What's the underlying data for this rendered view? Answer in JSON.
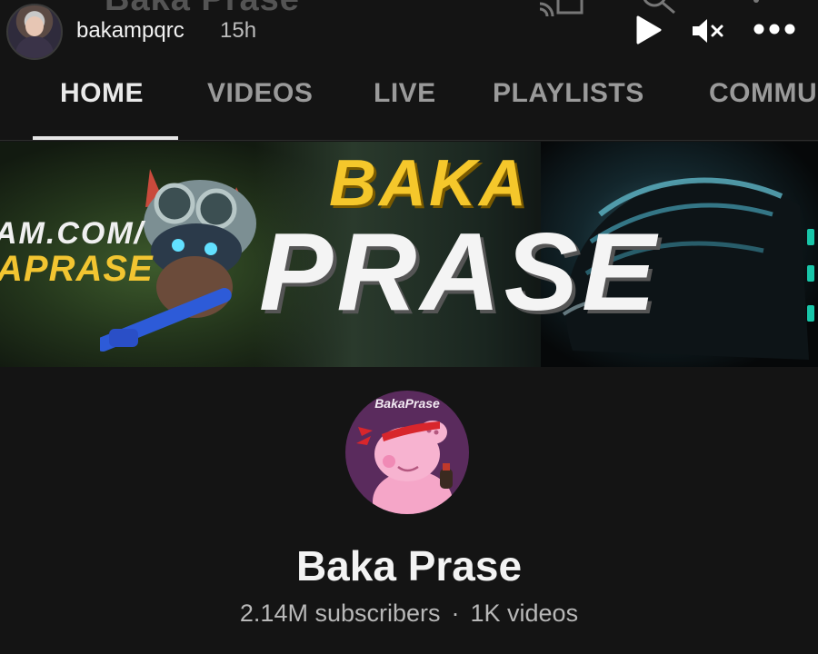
{
  "story": {
    "ghost_title": "Baka Prase",
    "username": "bakampqrc",
    "time_ago": "15h",
    "controls": {
      "play_icon": "play-icon",
      "mute_icon": "volume-muted-icon",
      "more_icon": "more-horizontal-icon"
    }
  },
  "tabs": [
    {
      "label": "HOME",
      "active": true
    },
    {
      "label": "VIDEOS",
      "active": false
    },
    {
      "label": "LIVE",
      "active": false
    },
    {
      "label": "PLAYLISTS",
      "active": false
    },
    {
      "label": "COMMU",
      "active": false
    }
  ],
  "banner": {
    "url_line1": "AM.COM/",
    "url_line2": "APRASE",
    "title_top": "BAKA",
    "title_bottom": "PRASE"
  },
  "channel": {
    "avatar_text": "BakaPrase",
    "name": "Baka Prase",
    "subscribers": "2.14M subscribers",
    "separator": "·",
    "videos": "1K videos"
  },
  "colors": {
    "background": "#141414",
    "accent_yellow": "#f5c72b",
    "accent_teal": "#18c6a9",
    "avatar_purple": "#5a2b5d",
    "peppa_pink": "#f5a6c8"
  }
}
